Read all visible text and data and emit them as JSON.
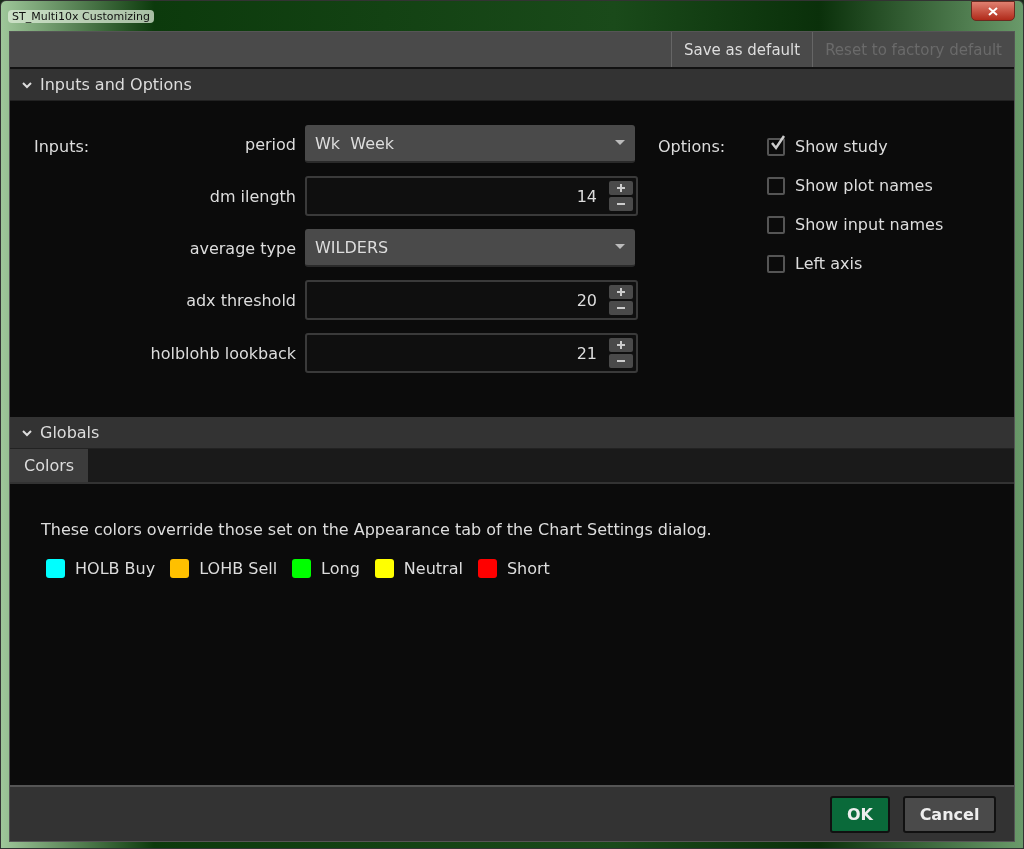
{
  "window": {
    "title": "ST_Multi10x Customizing"
  },
  "toolbar": [
    {
      "label": "Save as default",
      "disabled": false
    },
    {
      "label": "Reset to factory default",
      "disabled": true
    }
  ],
  "inputs_section": {
    "title": "Inputs and Options",
    "expanded": true,
    "inputs_label": "Inputs:",
    "options_label": "Options:",
    "inputs": [
      {
        "label": "period",
        "kind": "dropdown",
        "value": "Wk  Week"
      },
      {
        "label": "dm ilength",
        "kind": "spinner",
        "value": "14"
      },
      {
        "label": "average type",
        "kind": "dropdown",
        "value": "WILDERS"
      },
      {
        "label": "adx threshold",
        "kind": "spinner",
        "value": "20"
      },
      {
        "label": "holblohb lookback",
        "kind": "spinner",
        "value": "21"
      }
    ],
    "options": [
      {
        "label": "Show study",
        "checked": true
      },
      {
        "label": "Show plot names",
        "checked": false
      },
      {
        "label": "Show input names",
        "checked": false
      },
      {
        "label": "Left axis",
        "checked": false
      }
    ]
  },
  "globals_section": {
    "title": "Globals",
    "expanded": true,
    "tabs": [
      {
        "label": "Colors",
        "selected": true
      }
    ],
    "note": "These colors override those set on the Appearance tab of the Chart Settings dialog.",
    "colors": [
      {
        "label": "HOLB Buy",
        "color": "#00ffff"
      },
      {
        "label": "LOHB Sell",
        "color": "#ffc000"
      },
      {
        "label": "Long",
        "color": "#00ff00"
      },
      {
        "label": "Neutral",
        "color": "#ffff00"
      },
      {
        "label": "Short",
        "color": "#ff0000"
      }
    ]
  },
  "buttons": [
    {
      "label": "OK",
      "kind": "primary"
    },
    {
      "label": "Cancel",
      "kind": "secondary"
    }
  ]
}
